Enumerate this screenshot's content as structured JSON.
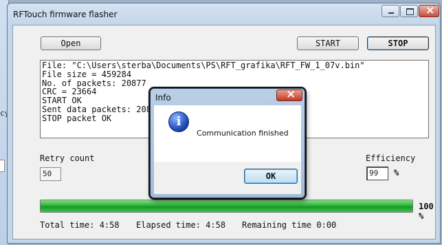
{
  "background_window": {
    "label_fragment": "cy"
  },
  "window": {
    "title": "RFTouch firmware flasher"
  },
  "toolbar": {
    "open_label": "Open",
    "start_label": "START",
    "stop_label": "STOP"
  },
  "log": {
    "lines": [
      "File: \"C:\\Users\\sterba\\Documents\\PS\\RFT_grafika\\RFT_FW_1_07v.bin\"",
      "File size = 459284",
      "No. of packets: 20877",
      "CRC = 23664",
      "START OK",
      "Sent data packets: 20877",
      "STOP packet OK"
    ]
  },
  "retry": {
    "label": "Retry count",
    "value": "50"
  },
  "efficiency": {
    "label": "Efficiency",
    "value": "99",
    "unit": "%"
  },
  "progress": {
    "percent": 100,
    "text": "100 %"
  },
  "times": {
    "total": "Total time: 4:58",
    "elapsed": "Elapsed time: 4:58",
    "remaining": "Remaining time 0:00"
  },
  "dialog": {
    "title": "Info",
    "message": "Communication finished",
    "ok_label": "OK",
    "icon": "information-icon"
  },
  "colors": {
    "progress_fill": "#2fb33a",
    "dialog_close": "#c23a26",
    "info_icon": "#1f4fbf"
  }
}
